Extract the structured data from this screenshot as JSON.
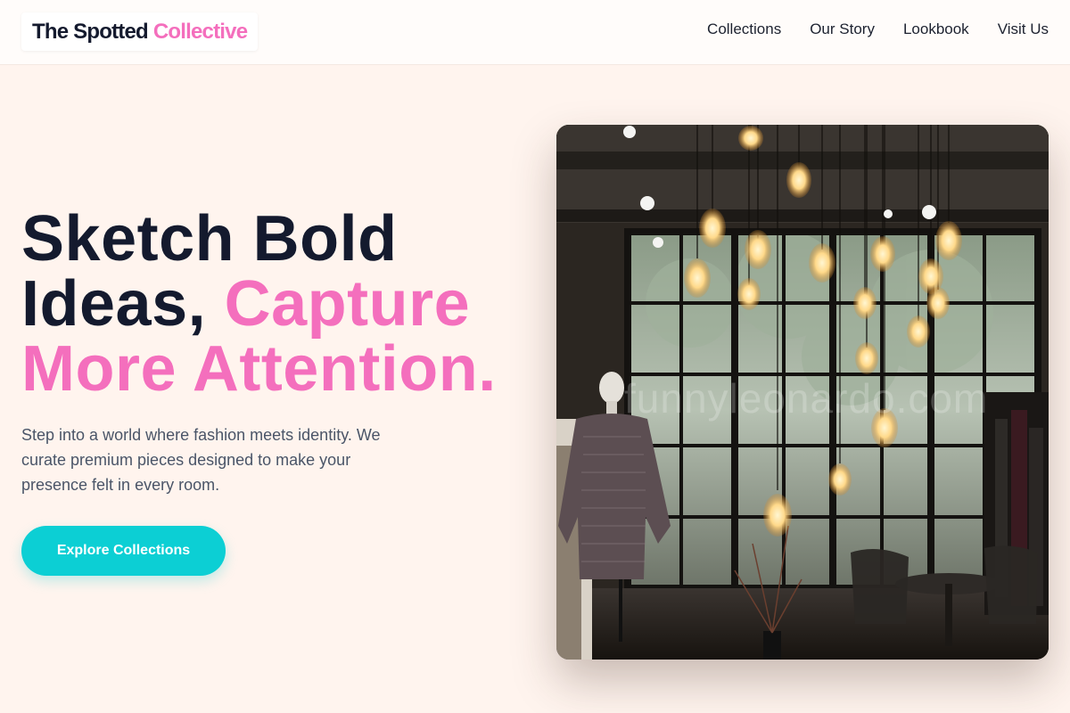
{
  "header": {
    "logo_primary": "The Spotted",
    "logo_accent": "Collective",
    "nav": [
      "Collections",
      "Our Story",
      "Lookbook",
      "Visit Us"
    ]
  },
  "hero": {
    "title_line1": "Sketch Bold",
    "title_line2_plain": "Ideas, ",
    "title_line2_pink": "Capture",
    "title_line3_pink": "More Attention.",
    "subtitle": "Step into a world where fashion meets identity. We curate premium pieces designed to make your presence felt in every room.",
    "cta_label": "Explore Collections"
  },
  "photo": {
    "watermark": "funnyleonardo.com"
  },
  "colors": {
    "accent_pink": "#f46fbd",
    "cta_teal": "#0ccfd4",
    "ink": "#141a2e",
    "background": "#fff4ee"
  }
}
